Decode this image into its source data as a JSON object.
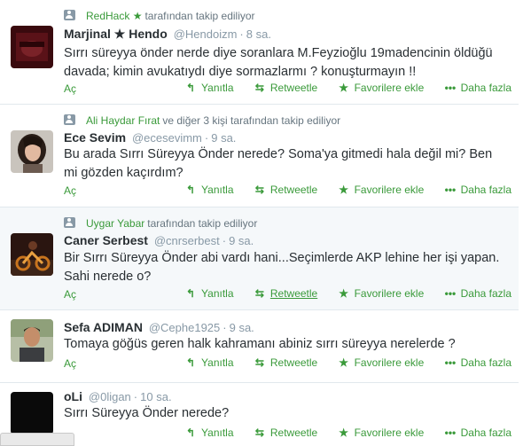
{
  "actions": {
    "expand": "Aç",
    "reply": "Yanıtla",
    "retweet": "Retweetle",
    "favorite": "Favorilere ekle",
    "more": "Daha fazla"
  },
  "icons": {
    "reply": "reply-arrow",
    "retweet": "retweet-arrows",
    "favorite": "star",
    "more": "three-dots"
  },
  "colors": {
    "accent": "#3a9a3a",
    "muted": "#8899a6",
    "text": "#292f33"
  },
  "tweets": [
    {
      "context_name": "RedHack",
      "context_star": "★",
      "context_text": "tarafından takip ediliyor",
      "fullname": "Marjinal ★ Hendo",
      "username": "@Hendoizm",
      "time": "8 sa.",
      "text": "Sırrı süreyya önder nerde diye soranlara M.Feyzioğlu 19madencinin öldüğü davada; kimin avukatıydı diye sormazlarmı ? konuşturmayın !!",
      "avatar_icon": "avatar-dark-red"
    },
    {
      "context_name": "Ali Haydar Fırat",
      "context_text": "ve diğer 3 kişi tarafından takip ediliyor",
      "fullname": "Ece Sevim",
      "username": "@ecesevimm",
      "time": "9 sa.",
      "text": "Bu arada Sırrı Süreyya Önder nerede? Soma'ya gitmedi hala değil mi? Ben mi gözden kaçırdım?",
      "avatar_icon": "avatar-woman-photo"
    },
    {
      "context_name": "Uygar Yabar",
      "context_text": "tarafından takip ediliyor",
      "fullname": "Caner Serbest",
      "username": "@cnrserbest",
      "time": "9 sa.",
      "text": "Bir Sırrı Süreyya Önder abi vardı hani...Seçimlerde AKP lehine her işi yapan. Sahi nerede o?",
      "avatar_icon": "avatar-motorcycle-photo"
    },
    {
      "fullname": "Sefa ADIMAN",
      "username": "@Cephe1925",
      "time": "9 sa.",
      "text": "Tomaya göğüs geren halk kahramanı abiniz sırrı süreyya nerelerde ?",
      "avatar_icon": "avatar-man-photo"
    },
    {
      "fullname": "oLi",
      "username": "@0ligan",
      "time": "10 sa.",
      "text": "Sırrı Süreyya Önder nerede?",
      "avatar_icon": "avatar-black"
    }
  ]
}
